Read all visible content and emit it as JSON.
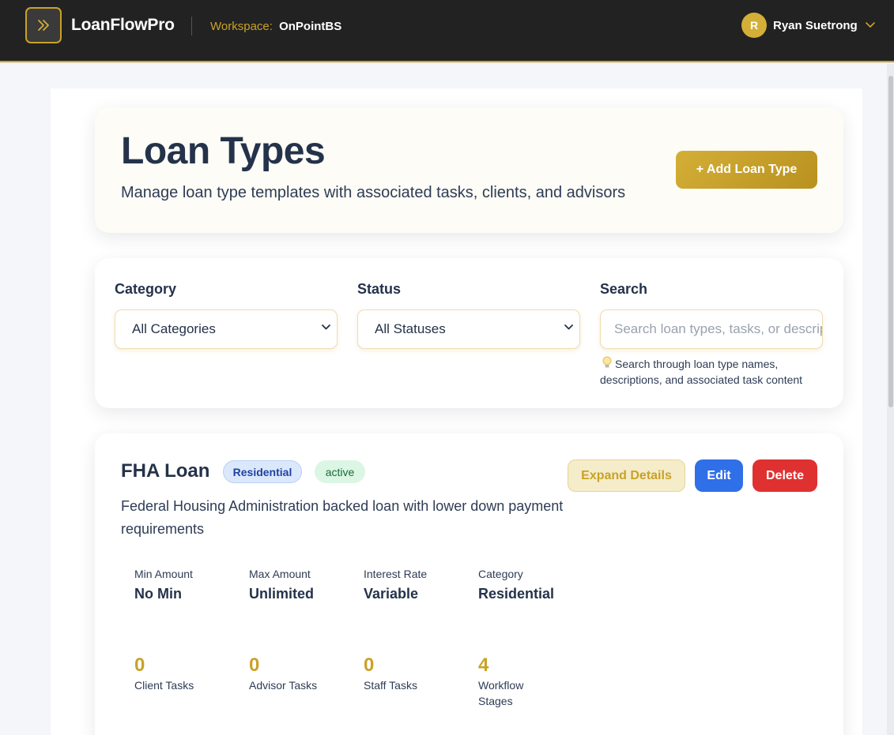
{
  "app": {
    "brand": "LoanFlowPro",
    "workspace_label": "Workspace:",
    "workspace_name": "OnPointBS",
    "user_initial": "R",
    "user_name": "Ryan Suetrong"
  },
  "header": {
    "title": "Loan Types",
    "subtitle": "Manage loan type templates with associated tasks, clients, and advisors",
    "add_button": "+ Add Loan Type"
  },
  "filters": {
    "category_label": "Category",
    "category_value": "All Categories",
    "status_label": "Status",
    "status_value": "All Statuses",
    "search_label": "Search",
    "search_placeholder": "Search loan types, tasks, or descriptions",
    "search_hint": "Search through loan type names, descriptions, and associated task content"
  },
  "loan": {
    "name": "FHA Loan",
    "category_badge": "Residential",
    "status_badge": "active",
    "expand_button": "Expand Details",
    "edit_button": "Edit",
    "delete_button": "Delete",
    "description": "Federal Housing Administration backed loan with lower down payment requirements",
    "details": [
      {
        "label": "Min Amount",
        "value": "No Min"
      },
      {
        "label": "Max Amount",
        "value": "Unlimited"
      },
      {
        "label": "Interest Rate",
        "value": "Variable"
      },
      {
        "label": "Category",
        "value": "Residential"
      }
    ],
    "counts": [
      {
        "value": "0",
        "label": "Client Tasks"
      },
      {
        "value": "0",
        "label": "Advisor Tasks"
      },
      {
        "value": "0",
        "label": "Staff Tasks"
      },
      {
        "value": "4",
        "label": "Workflow Stages"
      }
    ]
  },
  "colors": {
    "accent": "#c9a227",
    "topbar": "#222222",
    "edit": "#2f6fe8",
    "delete": "#e03131"
  }
}
